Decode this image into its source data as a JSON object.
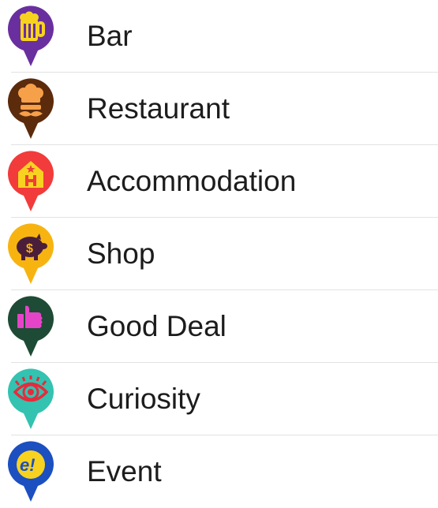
{
  "categories": [
    {
      "label": "Bar",
      "icon": "beer-mug-icon",
      "color": "#6a2f9f"
    },
    {
      "label": "Restaurant",
      "icon": "chef-icon",
      "color": "#5b2b0c"
    },
    {
      "label": "Accommodation",
      "icon": "hotel-icon",
      "color": "#f23b3b"
    },
    {
      "label": "Shop",
      "icon": "piggy-bank-icon",
      "color": "#f7b411"
    },
    {
      "label": "Good Deal",
      "icon": "thumbs-up-icon",
      "color": "#1e4b35"
    },
    {
      "label": "Curiosity",
      "icon": "eye-icon",
      "color": "#33c3b0"
    },
    {
      "label": "Event",
      "icon": "event-icon",
      "color": "#1c4fc0"
    }
  ]
}
